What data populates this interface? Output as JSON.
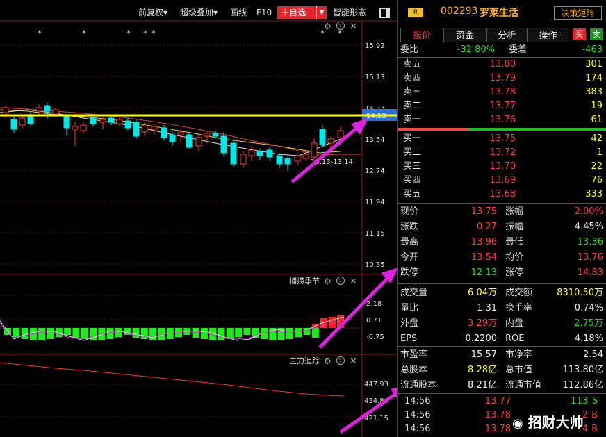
{
  "toolbar": {
    "items": [
      "前复权▾",
      "超级叠加▾",
      "画线",
      "F10"
    ],
    "favorite_label": "＋自选",
    "smart_label": "智能形态"
  },
  "main_chart": {
    "price_ticks": [
      "15.92",
      "15.13",
      "14.33",
      "13.54",
      "12.74",
      "11.94",
      "11.15",
      "10.35"
    ],
    "current_price_label": "14.13",
    "range_label": "13.13-13.14"
  },
  "indicator1": {
    "title": "捕捞季节",
    "ticks": [
      "2.18",
      "0.71",
      "-0.75"
    ]
  },
  "indicator2": {
    "title": "主力追踪",
    "ticks": [
      "447.93",
      "434.84",
      "421.15"
    ]
  },
  "stock": {
    "badge": "R",
    "code": "002293",
    "name": "罗莱生活",
    "decision_button": "决策矩阵"
  },
  "tabs": [
    "报价",
    "资金",
    "分析",
    "操作"
  ],
  "buy_label": "买",
  "sell_label": "卖",
  "order_ratio": {
    "label1": "委比",
    "value1": "-32.80%",
    "label2": "委差",
    "value2": "-463"
  },
  "asks": [
    {
      "label": "卖五",
      "price": "13.80",
      "volume": "301"
    },
    {
      "label": "卖四",
      "price": "13.79",
      "volume": "174"
    },
    {
      "label": "卖三",
      "price": "13.78",
      "volume": "383"
    },
    {
      "label": "卖二",
      "price": "13.77",
      "volume": "19"
    },
    {
      "label": "卖一",
      "price": "13.76",
      "volume": "61"
    }
  ],
  "bids": [
    {
      "label": "买一",
      "price": "13.75",
      "volume": "42"
    },
    {
      "label": "买二",
      "price": "13.72",
      "volume": "1"
    },
    {
      "label": "买三",
      "price": "13.70",
      "volume": "22"
    },
    {
      "label": "买四",
      "price": "13.69",
      "volume": "76"
    },
    {
      "label": "买五",
      "price": "13.68",
      "volume": "333"
    }
  ],
  "quote": [
    {
      "l1": "现价",
      "v1": "13.75",
      "c1": "red",
      "l2": "涨幅",
      "v2": "2.00%",
      "c2": "red"
    },
    {
      "l1": "涨跌",
      "v1": "0.27",
      "c1": "red",
      "l2": "振幅",
      "v2": "4.45%",
      "c2": "white"
    },
    {
      "l1": "最高",
      "v1": "13.96",
      "c1": "red",
      "l2": "最低",
      "v2": "13.36",
      "c2": "green"
    },
    {
      "l1": "今开",
      "v1": "13.54",
      "c1": "red",
      "l2": "均价",
      "v2": "13.76",
      "c2": "red"
    },
    {
      "l1": "跌停",
      "v1": "12.13",
      "c1": "green",
      "l2": "涨停",
      "v2": "14.83",
      "c2": "red"
    }
  ],
  "stats": [
    {
      "l1": "成交量",
      "v1": "6.04万",
      "c1": "yellow",
      "l2": "成交额",
      "v2": "8310.50万",
      "c2": "yellow"
    },
    {
      "l1": "量比",
      "v1": "1.31",
      "c1": "white",
      "l2": "换手率",
      "v2": "0.74%",
      "c2": "white"
    },
    {
      "l1": "外盘",
      "v1": "3.29万",
      "c1": "red",
      "l2": "内盘",
      "v2": "2.75万",
      "c2": "green"
    },
    {
      "l1": "EPS",
      "v1": "0.2200",
      "c1": "white",
      "l2": "ROE",
      "v2": "4.18%",
      "c2": "white"
    }
  ],
  "fundamentals": [
    {
      "l1": "市盈率",
      "v1": "15.57",
      "c1": "white",
      "l2": "市净率",
      "v2": "2.54",
      "c2": "white"
    },
    {
      "l1": "总股本",
      "v1": "8.28亿",
      "c1": "yellow",
      "l2": "总市值",
      "v2": "113.80亿",
      "c2": "white"
    },
    {
      "l1": "流通股本",
      "v1": "8.21亿",
      "c1": "white",
      "l2": "流通市值",
      "v2": "112.86亿",
      "c2": "white"
    }
  ],
  "ticks": [
    {
      "time": "14:56",
      "price": "13.77",
      "volume": "113",
      "side": "S"
    },
    {
      "time": "14:56",
      "price": "13.78",
      "volume": "2",
      "side": "B"
    },
    {
      "time": "14:56",
      "price": "13.78",
      "volume": "4",
      "side": "B"
    }
  ],
  "watermark": "招财大帅",
  "colors": {
    "up": "#ff3b3b",
    "down": "#18e018",
    "accent": "#e0262b",
    "arrow": "#e020e0",
    "level": "#ffff00"
  }
}
